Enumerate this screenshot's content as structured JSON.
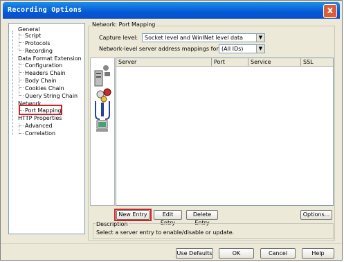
{
  "window": {
    "title": "Recording Options",
    "close_symbol": "x"
  },
  "tree": {
    "items": [
      {
        "label": "General"
      },
      {
        "label": "Script"
      },
      {
        "label": "Protocols"
      },
      {
        "label": "Recording"
      },
      {
        "label": "Data Format Extension"
      },
      {
        "label": "Configuration"
      },
      {
        "label": "Headers Chain"
      },
      {
        "label": "Body Chain"
      },
      {
        "label": "Cookies Chain"
      },
      {
        "label": "Query String Chain"
      },
      {
        "label": "Network"
      },
      {
        "label": "Port Mapping"
      },
      {
        "label": "HTTP Properties"
      },
      {
        "label": "Advanced"
      },
      {
        "label": "Correlation"
      }
    ],
    "selected": "Port Mapping"
  },
  "panel": {
    "group_label": "Network: Port Mapping",
    "capture_label": "Capture level:",
    "capture_value": "Socket level and WinINet level data",
    "mapping_label": "Network-level server address mappings for :",
    "mapping_value": "(All IDs)",
    "columns": [
      "Server",
      "Port",
      "Service",
      "SSL"
    ],
    "rows": []
  },
  "buttons": {
    "new_entry": "New Entry",
    "edit_entry": "Edit Entry",
    "delete_entry": "Delete Entry",
    "options": "Options..."
  },
  "description": {
    "label": "Description",
    "text": "Select a server entry to enable/disable or update."
  },
  "footer": {
    "use_defaults": "Use Defaults",
    "ok": "OK",
    "cancel": "Cancel",
    "help": "Help"
  },
  "colors": {
    "titlebar": "#0558d6",
    "window_bg": "#ece9d8",
    "highlight_box": "#d0202a"
  },
  "icons": [
    "computer-server-icon",
    "network-node-icon",
    "toolbox-icon",
    "monitor-icon"
  ]
}
